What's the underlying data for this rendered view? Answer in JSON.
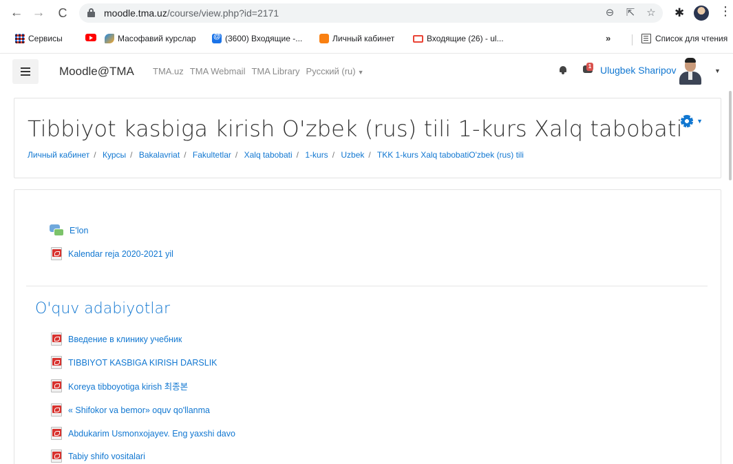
{
  "browser": {
    "url_host": "moodle.tma.uz",
    "url_path": "/course/view.php?id=2171",
    "bookmarks": [
      {
        "label": "Сервисы"
      },
      {
        "label": ""
      },
      {
        "label": "Масофавий курслар"
      },
      {
        "label": "(3600) Входящие -..."
      },
      {
        "label": "Личный кабинет"
      },
      {
        "label": "Входящие (26) - ul..."
      }
    ],
    "more_bookmarks": "»",
    "reading_list": "Список для чтения"
  },
  "navbar": {
    "brand": "Moodle@TMA",
    "links": [
      "TMA.uz",
      "TMA Webmail",
      "TMA Library"
    ],
    "language": "Русский (ru)",
    "message_count": "1",
    "username": "Ulugbek Sharipov"
  },
  "course": {
    "title": "Tibbiyot kasbiga kirish O'zbek (rus) tili 1-kurs Xalq tabobati",
    "breadcrumb": [
      "Личный кабинет",
      "Курсы",
      "Bakalavriat",
      "Fakultetlar",
      "Xalq tabobati",
      "1-kurs",
      "Uzbek",
      "TKK 1-kurs Xalq tabobatiO'zbek (rus) tili"
    ]
  },
  "general_section": {
    "activities": [
      {
        "label": "E'lon",
        "icon": "forum-icon"
      },
      {
        "label": "Kalendar reja 2020-2021 yil",
        "icon": "pdf-icon"
      }
    ]
  },
  "literature_section": {
    "title": "O'quv adabiyotlar",
    "activities": [
      {
        "label": "Введение в клинику учебник",
        "icon": "pdf-icon"
      },
      {
        "label": "TIBBIYOT KASBIGA KIRISH DARSLIK",
        "icon": "pdf-icon"
      },
      {
        "label": "Koreya tibboyotiga kirish 최종본",
        "icon": "pdf-icon"
      },
      {
        "label": "« Shifokor va bemor» oquv qo'llanma",
        "icon": "pdf-icon"
      },
      {
        "label": "Abdukarim Usmonxojayev. Eng yaxshi davo",
        "icon": "pdf-icon"
      },
      {
        "label": "Tabiy shifo vositalari",
        "icon": "pdf-icon"
      }
    ]
  }
}
